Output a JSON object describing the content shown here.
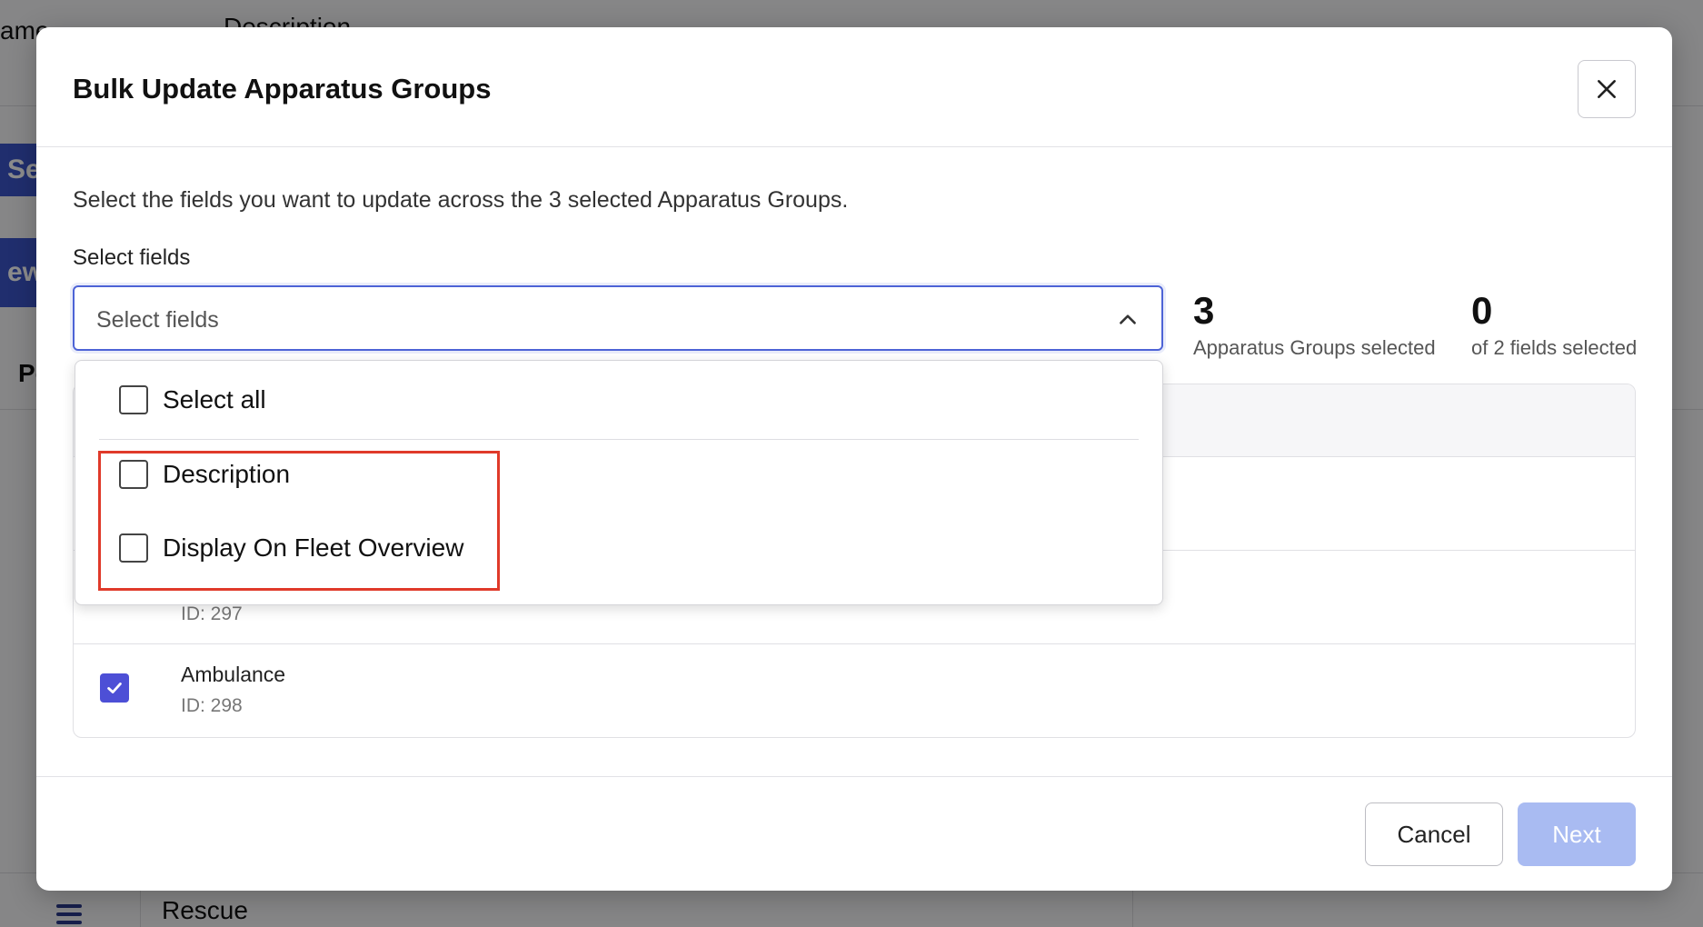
{
  "background": {
    "col_name": "ame",
    "col_description": "Description",
    "search_btn": "Sear",
    "new_btn": "ew",
    "section_heading": "Po",
    "bottom_row_name": "Rescue"
  },
  "modal": {
    "title": "Bulk Update Apparatus Groups",
    "intro": "Select the fields you want to update across the 3 selected Apparatus Groups.",
    "field_label": "Select fields",
    "select_placeholder": "Select fields",
    "stats": [
      {
        "value": "3",
        "label": "Apparatus Groups selected"
      },
      {
        "value": "0",
        "label": "of 2 fields selected"
      }
    ],
    "dropdown": {
      "select_all": "Select all",
      "options": [
        {
          "label": "Description",
          "checked": false
        },
        {
          "label": "Display On Fleet Overview",
          "checked": false
        }
      ]
    },
    "rows": [
      {
        "name": "",
        "id": ""
      },
      {
        "name": "",
        "id": "ID: 297"
      },
      {
        "name": "Ambulance",
        "id": "ID: 298",
        "checked": true
      }
    ],
    "footer": {
      "cancel": "Cancel",
      "next": "Next"
    }
  },
  "colors": {
    "accent": "#4d63d6",
    "checkbox_checked": "#4d4fd6",
    "next_disabled": "#a9bbf2",
    "highlight": "#e03a2a"
  }
}
